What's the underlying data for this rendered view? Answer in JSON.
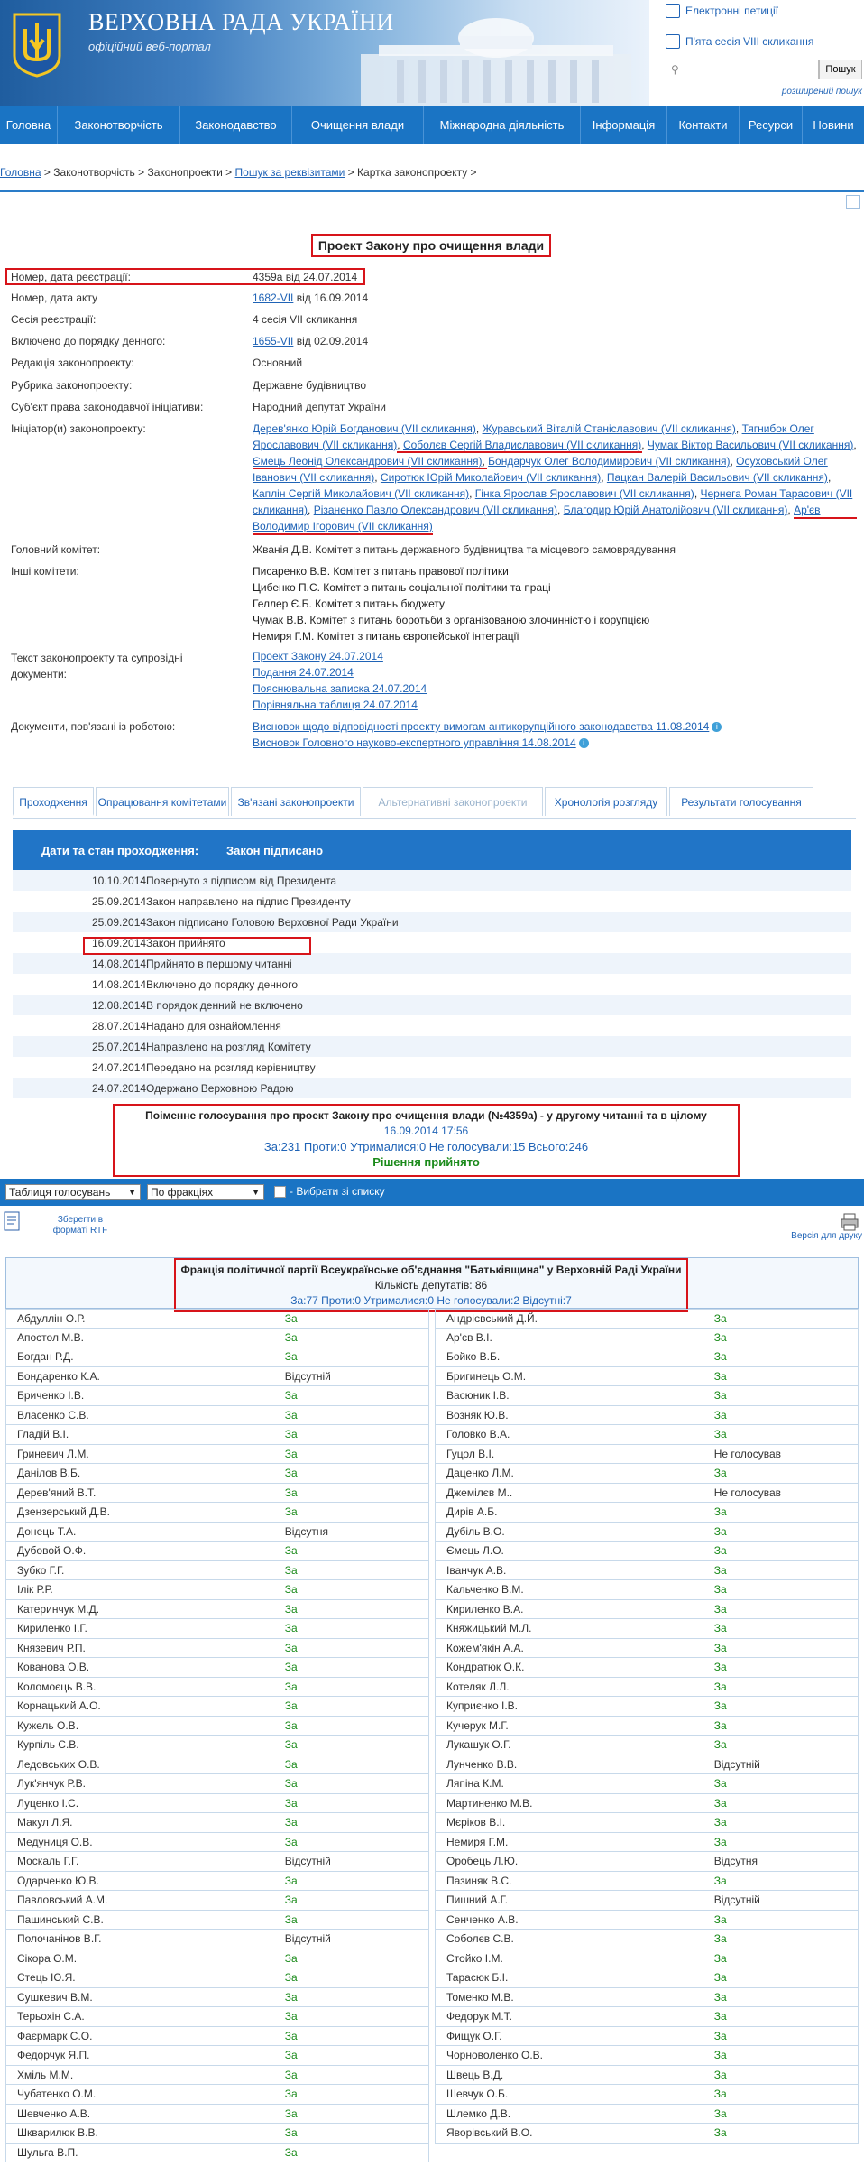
{
  "header": {
    "title": "ВЕРХОВНА РАДА УКРАЇНИ",
    "subtitle": "офіційний веб-портал",
    "links": [
      "Електронні петиції",
      "П'ята сесія VIII скликання"
    ],
    "search_button": "Пошук",
    "advanced_search": "розширений пошук"
  },
  "nav": [
    "Головна",
    "Законотворчість",
    "Законодавство",
    "Очищення влади",
    "Міжнародна діяльність",
    "Інформація",
    "Контакти",
    "Ресурси",
    "Новини"
  ],
  "breadcrumb": {
    "home": "Головна",
    "p1": " > Законотворчість > Законопроекти > ",
    "search": "Пошук за реквізитами",
    "p2": " > Картка законопроекту >"
  },
  "bill": {
    "title": "Проект Закону про очищення влади",
    "fields": [
      {
        "label": "Номер, дата реєстрації:",
        "value": "4359а від 24.07.2014"
      },
      {
        "label": "Номер, дата акту",
        "link": "1682-VII",
        "value": " від 16.09.2014"
      },
      {
        "label": "Сесія реєстрації:",
        "value": "4 сесія VII скликання"
      },
      {
        "label": "Включено до порядку денного:",
        "link": "1655-VII",
        "value": " від 02.09.2014"
      },
      {
        "label": "Редакція законопроекту:",
        "value": "Основний"
      },
      {
        "label": "Рубрика законопроекту:",
        "value": "Державне будівництво"
      },
      {
        "label": "Суб'єкт права законодавчої ініціативи:",
        "value": "Народний депутат України"
      }
    ],
    "initiators_label": "Ініціатор(и) законопроекту:",
    "initiators": [
      "Дерев'янко Юрій Богданович (VII скликання)",
      "Журавський Віталій Станіславович (VII скликання)",
      "Тягнибок Олег Ярославович (VII скликання)",
      "Соболєв Сергій Владиславович (VII скликання)",
      "Чумак Віктор Васильович (VII скликання)",
      "Ємець Леонід Олександрович (VII скликання)",
      "Бондарчук Олег Володимирович (VII скликання)",
      "Осуховський Олег Іванович (VII скликання)",
      "Сиротюк Юрій Миколайович (VII скликання)",
      "Пацкан Валерій Васильович (VII скликання)",
      "Каплін Сергій Миколайович (VII скликання)",
      "Гінка Ярослав Ярославович (VII скликання)",
      "Чернега Роман Тарасович (VII скликання)",
      "Різаненко Павло Олександрович (VII скликання)",
      "Благодир Юрій Анатолійович (VII скликання)",
      "Ар'єв Володимир Ігорович (VII скликання)"
    ],
    "main_committee_label": "Головний комітет:",
    "main_committee": "Жванія Д.В. Комітет з питань державного будівництва та місцевого самоврядування",
    "other_committees_label": "Інші комітети:",
    "other_committees": [
      "Писаренко В.В. Комітет з питань правової політики",
      "Цибенко П.С. Комітет з питань соціальної політики та праці",
      "Геллер Є.Б. Комітет з питань бюджету",
      "Чумак В.В. Комітет з питань боротьби з організованою злочинністю і корупцією",
      "Немиря Г.М. Комітет з питань європейської інтеграції"
    ],
    "texts_label": "Текст законопроекту та супровідні документи:",
    "texts": [
      "Проект Закону 24.07.2014",
      "Подання 24.07.2014",
      "Пояснювальна записка 24.07.2014",
      "Порівняльна таблиця 24.07.2014"
    ],
    "related_label": "Документи, пов'язані із роботою:",
    "related": [
      "Висновок щодо відповідності проекту вимогам антикорупційного законодавства 11.08.2014",
      "Висновок Головного науково-експертного управління 14.08.2014"
    ]
  },
  "tabs": [
    "Проходження",
    "Опрацювання комітетами",
    "Зв'язані законопроекти",
    "Альтернативні законопроекти",
    "Хронологія розгляду",
    "Результати голосування"
  ],
  "passage": {
    "head_date": "Дати та стан проходження:",
    "head_status": "Закон підписано",
    "rows": [
      [
        "10.10.2014",
        "Повернуто з підписом від Президента"
      ],
      [
        "25.09.2014",
        "Закон направлено на підпис Президенту"
      ],
      [
        "25.09.2014",
        "Закон підписано Головою Верховної Ради України"
      ],
      [
        "16.09.2014",
        "Закон прийнято"
      ],
      [
        "14.08.2014",
        "Прийнято в першому читанні"
      ],
      [
        "14.08.2014",
        "Включено до порядку денного"
      ],
      [
        "12.08.2014",
        "В порядок денний не включено"
      ],
      [
        "28.07.2014",
        "Надано для ознайомлення"
      ],
      [
        "25.07.2014",
        "Направлено на розгляд Комітету"
      ],
      [
        "24.07.2014",
        "Передано на розгляд керівництву"
      ],
      [
        "24.07.2014",
        "Одержано Верховною Радою"
      ]
    ]
  },
  "vote": {
    "title": "Поіменне голосування про проект Закону про очищення влади (№4359а) - у другому читанні та в цілому",
    "datetime": "16.09.2014 17:56",
    "totals": "За:231 Проти:0 Утрималися:0 Не голосували:15 Всього:246",
    "decision": "Рішення прийнято",
    "select_table": "Таблиця голосувань",
    "select_group": "По фракціях",
    "checkbox_label": "- Вибрати зі списку",
    "save_rtf": "Зберегти в форматі RTF",
    "print_version": "Версія для друку"
  },
  "faction": {
    "title": "Фракція політичної партії Всеукраїнське об'єднання \"Батьківщина\" у Верховній Раді України",
    "count": "Кількість депутатів: 86",
    "totals": "За:77 Проти:0 Утрималися:0 Не голосували:2 Відсутні:7",
    "left": [
      [
        "Абдуллін О.Р.",
        "За"
      ],
      [
        "Апостол М.В.",
        "За"
      ],
      [
        "Богдан Р.Д.",
        "За"
      ],
      [
        "Бондаренко К.А.",
        "Відсутній"
      ],
      [
        "Бриченко І.В.",
        "За"
      ],
      [
        "Власенко С.В.",
        "За"
      ],
      [
        "Гладій В.І.",
        "За"
      ],
      [
        "Гриневич Л.М.",
        "За"
      ],
      [
        "Данілов В.Б.",
        "За"
      ],
      [
        "Дерев'яний В.Т.",
        "За"
      ],
      [
        "Дзензерський Д.В.",
        "За"
      ],
      [
        "Донець Т.А.",
        "Відсутня"
      ],
      [
        "Дубовой О.Ф.",
        "За"
      ],
      [
        "Зубко Г.Г.",
        "За"
      ],
      [
        "Ілік Р.Р.",
        "За"
      ],
      [
        "Катеринчук М.Д.",
        "За"
      ],
      [
        "Кириленко І.Г.",
        "За"
      ],
      [
        "Князевич Р.П.",
        "За"
      ],
      [
        "Кованова О.В.",
        "За"
      ],
      [
        "Коломоєць В.В.",
        "За"
      ],
      [
        "Корнацький А.О.",
        "За"
      ],
      [
        "Кужель О.В.",
        "За"
      ],
      [
        "Курпіль С.В.",
        "За"
      ],
      [
        "Ледовських О.В.",
        "За"
      ],
      [
        "Лук'янчук Р.В.",
        "За"
      ],
      [
        "Луценко І.С.",
        "За"
      ],
      [
        "Макул Л.Я.",
        "За"
      ],
      [
        "Медуниця О.В.",
        "За"
      ],
      [
        "Москаль Г.Г.",
        "Відсутній"
      ],
      [
        "Одарченко Ю.В.",
        "За"
      ],
      [
        "Павловський А.М.",
        "За"
      ],
      [
        "Пашинський С.В.",
        "За"
      ],
      [
        "Полочанінов В.Г.",
        "Відсутній"
      ],
      [
        "Сікора О.М.",
        "За"
      ],
      [
        "Стець Ю.Я.",
        "За"
      ],
      [
        "Сушкевич В.М.",
        "За"
      ],
      [
        "Терьохін С.А.",
        "За"
      ],
      [
        "Фаєрмарк С.О.",
        "За"
      ],
      [
        "Федорчук Я.П.",
        "За"
      ],
      [
        "Хміль М.М.",
        "За"
      ],
      [
        "Чубатенко О.М.",
        "За"
      ],
      [
        "Шевченко А.В.",
        "За"
      ],
      [
        "Шкварилюк В.В.",
        "За"
      ],
      [
        "Шульга В.П.",
        "За"
      ]
    ],
    "right": [
      [
        "Андрієвський Д.Й.",
        "За"
      ],
      [
        "Ар'єв В.І.",
        "За"
      ],
      [
        "Бойко В.Б.",
        "За"
      ],
      [
        "Бригинець О.М.",
        "За"
      ],
      [
        "Васюник І.В.",
        "За"
      ],
      [
        "Возняк Ю.В.",
        "За"
      ],
      [
        "Головко В.А.",
        "За"
      ],
      [
        "Гуцол В.І.",
        "Не голосував"
      ],
      [
        "Даценко Л.М.",
        "За"
      ],
      [
        "Джемілєв М..",
        "Не голосував"
      ],
      [
        "Дирів А.Б.",
        "За"
      ],
      [
        "Дубіль В.О.",
        "За"
      ],
      [
        "Ємець Л.О.",
        "За"
      ],
      [
        "Іванчук А.В.",
        "За"
      ],
      [
        "Кальченко В.М.",
        "За"
      ],
      [
        "Кириленко В.А.",
        "За"
      ],
      [
        "Княжицький М.Л.",
        "За"
      ],
      [
        "Кожем'якін А.А.",
        "За"
      ],
      [
        "Кондратюк О.К.",
        "За"
      ],
      [
        "Котеляк Л.Л.",
        "За"
      ],
      [
        "Куприєнко І.В.",
        "За"
      ],
      [
        "Кучерук М.Г.",
        "За"
      ],
      [
        "Лукашук О.Г.",
        "За"
      ],
      [
        "Лунченко В.В.",
        "Відсутній"
      ],
      [
        "Ляпіна К.М.",
        "За"
      ],
      [
        "Мартиненко М.В.",
        "За"
      ],
      [
        "Мєріков В.І.",
        "За"
      ],
      [
        "Немиря Г.М.",
        "За"
      ],
      [
        "Оробець Л.Ю.",
        "Відсутня"
      ],
      [
        "Пазиняк В.С.",
        "За"
      ],
      [
        "Пишний А.Г.",
        "Відсутній"
      ],
      [
        "Сенченко А.В.",
        "За"
      ],
      [
        "Соболєв С.В.",
        "За"
      ],
      [
        "Стойко І.М.",
        "За"
      ],
      [
        "Тарасюк Б.І.",
        "За"
      ],
      [
        "Томенко М.В.",
        "За"
      ],
      [
        "Федорук М.Т.",
        "За"
      ],
      [
        "Фищук О.Г.",
        "За"
      ],
      [
        "Чорноволенко О.В.",
        "За"
      ],
      [
        "Швець В.Д.",
        "За"
      ],
      [
        "Шевчук О.Б.",
        "За"
      ],
      [
        "Шлемко Д.В.",
        "За"
      ],
      [
        "Яворівський В.О.",
        "За"
      ]
    ]
  }
}
